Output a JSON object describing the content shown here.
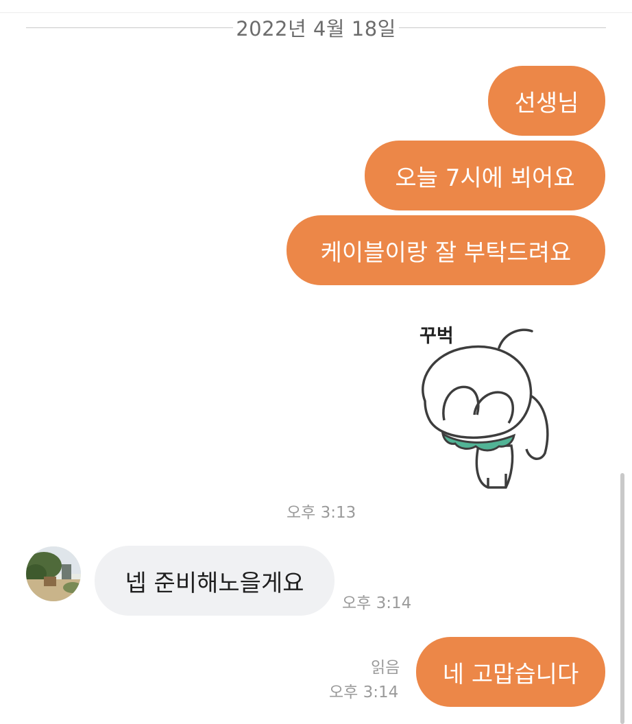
{
  "date_separator": "2022년 4월 18일",
  "messages": {
    "out1": "선생님",
    "out2": "오늘 7시에 뵈어요",
    "out3": "케이블이랑 잘 부탁드려요",
    "sticker_text": "꾸벅",
    "sticker_time": "오후 3:13",
    "in1": "넵 준비해노을게요",
    "in1_time": "오후 3:14",
    "out4": "네 고맙습니다",
    "out4_read": "읽음",
    "out4_time": "오후 3:14"
  },
  "colors": {
    "outgoing_bubble": "#ec8748",
    "incoming_bubble": "#f0f1f3",
    "meta_text": "#9a9a9a"
  }
}
